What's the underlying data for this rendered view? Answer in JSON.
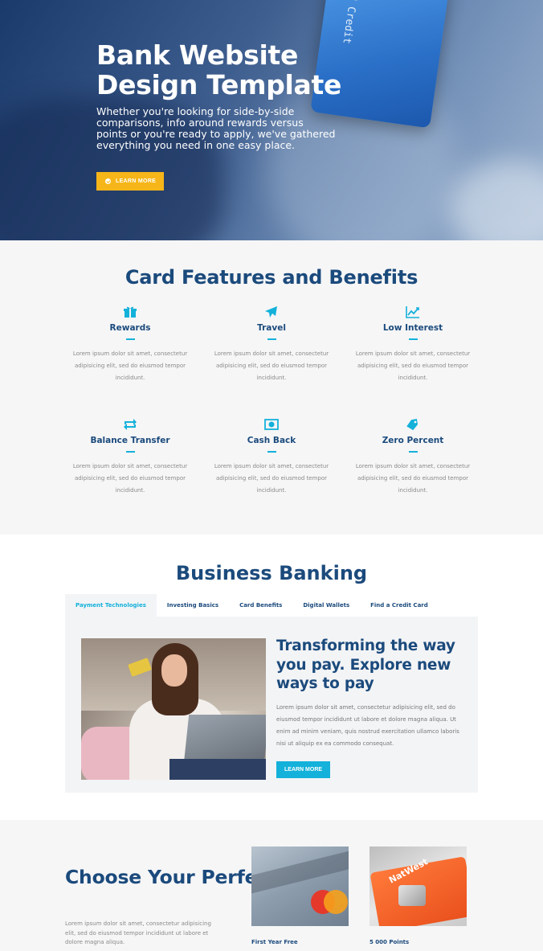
{
  "hero": {
    "title": "Bank Website Design Template",
    "subtitle": "Whether you're looking for side-by-side comparisons, info around rewards versus points or you're ready to apply, we've gathered everything you need in one easy place.",
    "button": "LEARN MORE",
    "card_text": "IM Credit"
  },
  "features": {
    "title": "Card Features and Benefits",
    "items": [
      {
        "label": "Rewards",
        "icon": "gift-icon",
        "text": "Lorem ipsum dolor sit amet, consectetur adipisicing elit, sed do eiusmod tempor incididunt."
      },
      {
        "label": "Travel",
        "icon": "plane-icon",
        "text": "Lorem ipsum dolor sit amet, consectetur adipisicing elit, sed do eiusmod tempor incididunt."
      },
      {
        "label": "Low Interest",
        "icon": "chart-line-icon",
        "text": "Lorem ipsum dolor sit amet, consectetur adipisicing elit, sed do eiusmod tempor incididunt."
      },
      {
        "label": "Balance Transfer",
        "icon": "exchange-icon",
        "text": "Lorem ipsum dolor sit amet, consectetur adipisicing elit, sed do eiusmod tempor incididunt."
      },
      {
        "label": "Cash Back",
        "icon": "money-bill-icon",
        "text": "Lorem ipsum dolor sit amet, consectetur adipisicing elit, sed do eiusmod tempor incididunt."
      },
      {
        "label": "Zero Percent",
        "icon": "tag-icon",
        "text": "Lorem ipsum dolor sit amet, consectetur adipisicing elit, sed do eiusmod tempor incididunt."
      }
    ]
  },
  "business": {
    "title": "Business Banking",
    "tabs": [
      "Payment Technologies",
      "Investing Basics",
      "Card Benefits",
      "Digital Wallets",
      "Find a Credit Card"
    ],
    "active_tab": "Payment Technologies",
    "panel_title": "Transforming the way you pay. Explore new ways to pay",
    "panel_text": "Lorem ipsum dolor sit amet, consectetur adipisicing elit, sed do eiusmod tempor incididunt ut labore et dolore magna aliqua. Ut enim ad minim veniam, quis nostrud exercitation ullamco laboris nisi ut aliquip ex ea commodo consequat.",
    "panel_button": "LEARN MORE"
  },
  "choose": {
    "title": "Choose Your Perfect Card",
    "text": "Lorem ipsum dolor sit amet, consectetur adipisicing elit, sed do eiusmod tempor incididunt ut labore et dolore magna aliqua.",
    "cards": [
      {
        "label": "First Year Free"
      },
      {
        "label": "5 000 Points",
        "brand_text": "NatWest"
      }
    ]
  },
  "colors": {
    "accent": "#14b1da",
    "primary": "#1b4a7c",
    "cta": "#f6b619"
  }
}
